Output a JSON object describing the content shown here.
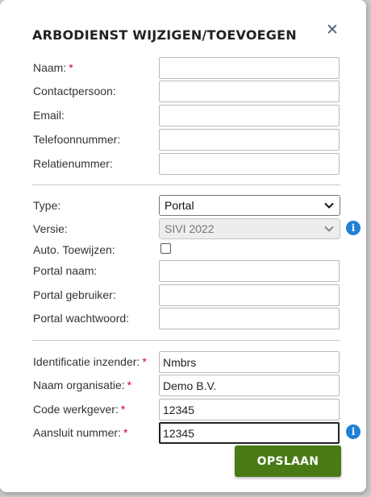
{
  "dialog": {
    "title": "ARBODIENST WIJZIGEN/TOEVOEGEN",
    "close_icon": "close-icon",
    "required_marker": "*",
    "save_label": "OPSLAAN"
  },
  "section1": {
    "naam": {
      "label": "Naam:",
      "required": true,
      "value": ""
    },
    "contactpersoon": {
      "label": "Contactpersoon:",
      "value": ""
    },
    "email": {
      "label": "Email:",
      "value": ""
    },
    "telefoonnummer": {
      "label": "Telefoonnummer:",
      "value": ""
    },
    "relatienummer": {
      "label": "Relatienummer:",
      "value": ""
    }
  },
  "section2": {
    "type": {
      "label": "Type:",
      "value": "Portal"
    },
    "versie": {
      "label": "Versie:",
      "value": "SIVI 2022",
      "disabled": true,
      "info_icon": "info-icon"
    },
    "auto_toewijzen": {
      "label": "Auto. Toewijzen:",
      "checked": false
    },
    "portal_naam": {
      "label": "Portal naam:",
      "value": ""
    },
    "portal_gebruiker": {
      "label": "Portal gebruiker:",
      "value": ""
    },
    "portal_wachtwoord": {
      "label": "Portal wachtwoord:",
      "value": ""
    }
  },
  "section3": {
    "identificatie_inzender": {
      "label": "Identificatie inzender:",
      "required": true,
      "value": "Nmbrs"
    },
    "naam_organisatie": {
      "label": "Naam organisatie:",
      "required": true,
      "value": "Demo B.V."
    },
    "code_werkgever": {
      "label": "Code werkgever:",
      "required": true,
      "value": "12345"
    },
    "aansluit_nummer": {
      "label": "Aansluit nummer:",
      "required": true,
      "value": "12345",
      "info_icon": "info-icon"
    }
  },
  "colors": {
    "primary_button": "#4a7a16",
    "info": "#1f80d6",
    "required": "#d0021b"
  }
}
